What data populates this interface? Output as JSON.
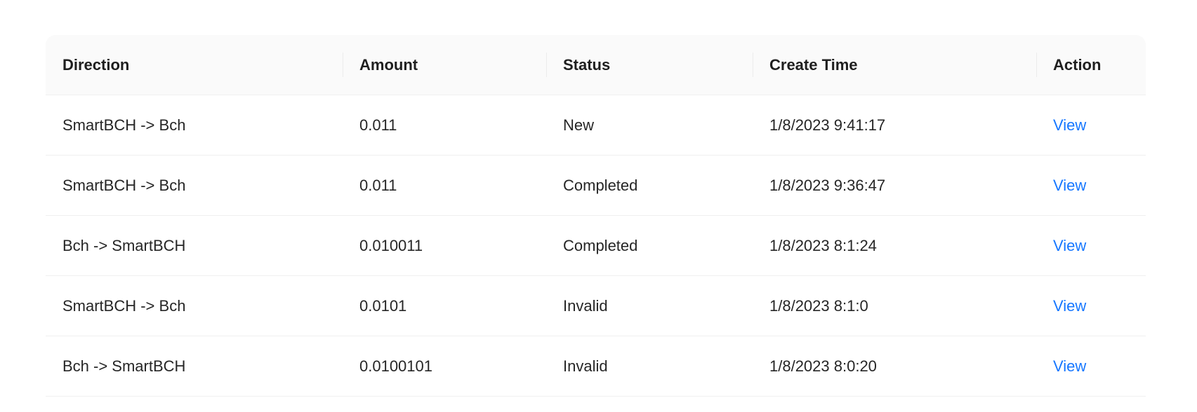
{
  "table": {
    "columns": [
      "Direction",
      "Amount",
      "Status",
      "Create Time",
      "Action"
    ],
    "rows": [
      {
        "direction": "SmartBCH -> Bch",
        "amount": "0.011",
        "status": "New",
        "create_time": "1/8/2023 9:41:17",
        "action": "View"
      },
      {
        "direction": "SmartBCH -> Bch",
        "amount": "0.011",
        "status": "Completed",
        "create_time": "1/8/2023 9:36:47",
        "action": "View"
      },
      {
        "direction": "Bch -> SmartBCH",
        "amount": "0.010011",
        "status": "Completed",
        "create_time": "1/8/2023 8:1:24",
        "action": "View"
      },
      {
        "direction": "SmartBCH -> Bch",
        "amount": "0.0101",
        "status": "Invalid",
        "create_time": "1/8/2023 8:1:0",
        "action": "View"
      },
      {
        "direction": "Bch -> SmartBCH",
        "amount": "0.0100101",
        "status": "Invalid",
        "create_time": "1/8/2023 8:0:20",
        "action": "View"
      }
    ]
  },
  "colors": {
    "link": "#1677ff",
    "header_bg": "#fafafa",
    "row_border": "#f0f0f0"
  }
}
